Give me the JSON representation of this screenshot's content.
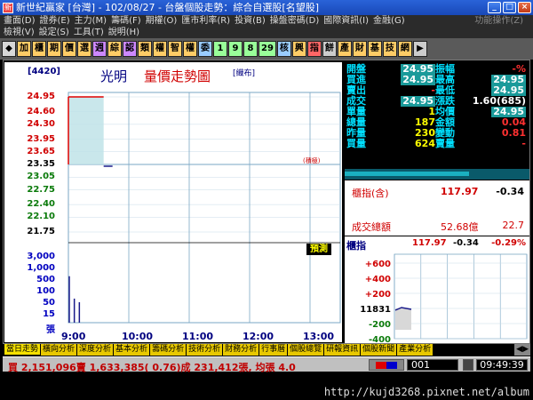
{
  "title_bar": {
    "text": "新世紀贏家 [台灣] - 102/08/27 - 台盤個股走勢：綜合自選股[名望股]",
    "minimize": "_",
    "restore": "□",
    "close": "×"
  },
  "menu1": {
    "items": [
      "畫面(D)",
      "證券(E)",
      "主力(M)",
      "籌碼(F)",
      "期權(O)",
      "匯市利率(R)",
      "投資(B)",
      "操盤密碼(D)",
      "國際資訊(I)",
      "金融(G)",
      "功能操作(Z)"
    ],
    "right": "功能操作(Z)"
  },
  "menu2": {
    "items": [
      "檢視(V)",
      "設定(S)",
      "工具(T)",
      "說明(H)"
    ]
  },
  "toolbar": {
    "buttons": [
      {
        "label": "◆",
        "color": "#d8d8d8"
      },
      {
        "label": "加",
        "color": "#ffcc66"
      },
      {
        "label": "櫃",
        "color": "#ffcc66"
      },
      {
        "label": "期",
        "color": "#ffcc66"
      },
      {
        "label": "價",
        "color": "#ffcc66"
      },
      {
        "label": "選",
        "color": "#ffcc66"
      },
      {
        "label": "週",
        "color": "#cc88ff"
      },
      {
        "label": "綜",
        "color": "#ffcc66"
      },
      {
        "label": "認",
        "color": "#cc88ff"
      },
      {
        "label": "類",
        "color": "#ffcc66"
      },
      {
        "label": "權",
        "color": "#ffcc66"
      },
      {
        "label": "智",
        "color": "#ffcc66"
      },
      {
        "label": "權",
        "color": "#ffcc66"
      },
      {
        "label": "委",
        "color": "#99ccff"
      },
      {
        "label": "1",
        "color": "#99ff99"
      },
      {
        "label": "9",
        "color": "#99ff99"
      },
      {
        "label": "8",
        "color": "#99ff99"
      },
      {
        "label": "29",
        "color": "#99ff99"
      },
      {
        "label": "核",
        "color": "#99ccff"
      },
      {
        "label": "興",
        "color": "#ffcc66"
      },
      {
        "label": "指",
        "color": "#ff6666"
      },
      {
        "label": "餅",
        "color": "#cccccc"
      },
      {
        "label": "產",
        "color": "#ffcc66"
      },
      {
        "label": "財",
        "color": "#ffcc66"
      },
      {
        "label": "基",
        "color": "#ffcc66"
      },
      {
        "label": "技",
        "color": "#ffcc66"
      },
      {
        "label": "網",
        "color": "#ffcc66"
      },
      {
        "label": "▶",
        "color": "#cccccc"
      }
    ]
  },
  "stock": {
    "code": "[4420]",
    "name": "光明",
    "view": "量價走勢圖",
    "weave": "[織布]",
    "predict_label": "預測",
    "turnover_label": "(積極)"
  },
  "chart_data": {
    "type": "line",
    "price_ticks": [
      "24.95",
      "24.60",
      "24.30",
      "23.95",
      "23.65",
      "23.35",
      "23.05",
      "22.75",
      "22.40",
      "22.10",
      "21.75"
    ],
    "volume_ticks": [
      "3,000",
      "1,000",
      "500",
      "100",
      "50",
      "15",
      "張"
    ],
    "time_ticks": [
      "9:00",
      "10:00",
      "11:00",
      "12:00",
      "13:00"
    ],
    "reference_price": 23.35,
    "price_points": [
      {
        "t": "9:00",
        "price": 24.95
      },
      {
        "t": "9:35",
        "price": 24.95
      }
    ],
    "volume_bars": [
      {
        "t": "9:00",
        "vol": 187
      },
      {
        "t": "9:05",
        "vol": 15
      },
      {
        "t": "9:10",
        "vol": 10
      }
    ]
  },
  "quote": {
    "rows": [
      {
        "k": "開盤",
        "v": "24.95",
        "k2": "振幅",
        "v2": "-%",
        "c": "#fff",
        "c2": "#ff3030",
        "box": true
      },
      {
        "k": "買進",
        "v": "24.95",
        "k2": "最高",
        "v2": "24.95",
        "c": "#fff",
        "c2": "#fff",
        "box": true,
        "box2": true
      },
      {
        "k": "賣出",
        "v": "-",
        "k2": "最低",
        "v2": "24.95",
        "c": "#ff3030",
        "c2": "#fff",
        "box2": true
      },
      {
        "k": "成交",
        "v": "24.95",
        "k2": "漲跌",
        "v2": "1.60(685)",
        "c": "#fff",
        "c2": "#fff",
        "box": true
      },
      {
        "k": "單量",
        "v": "1",
        "k2": "均價",
        "v2": "24.95",
        "c": "#ffff00",
        "c2": "#fff",
        "box2": true
      },
      {
        "k": "總量",
        "v": "187",
        "k2": "金額",
        "v2": "0.04",
        "c": "#ffff00",
        "c2": "#ff3030"
      },
      {
        "k": "昨量",
        "v": "230",
        "k2": "變動",
        "v2": "0.81",
        "c": "#ffff00",
        "c2": "#ff3030"
      },
      {
        "k": "買量",
        "v": "624",
        "k2": "賣量",
        "v2": "-",
        "c": "#ffff00",
        "c2": "#ff3030"
      }
    ]
  },
  "index_box": {
    "label": "櫃指(含)",
    "value": "117.97",
    "change": "-0.34",
    "amount_label": "成交總額",
    "amount": "52.68億",
    "amount2": "22.7"
  },
  "index_chart": {
    "label": "櫃指",
    "value": "117.97",
    "change": "-0.34",
    "pct": "-0.29%",
    "ticks": [
      "+600",
      "+400",
      "+200",
      "11831",
      "-200",
      "-400"
    ]
  },
  "tabs": {
    "items": [
      "當日走勢",
      "橫向分析",
      "深度分析",
      "基本分析",
      "籌碼分析",
      "技術分析",
      "財務分析",
      "行事曆",
      "個股總覽",
      "研報資訊",
      "個股新聞",
      "產業分析"
    ]
  },
  "status": {
    "text": "買 2,151,096賣 1,633,385( 0.76)成 231,412張, 均張 4.0",
    "page": "001",
    "clock": "09:49:39"
  },
  "watermark": "http://kujd3268.pixnet.net/album"
}
